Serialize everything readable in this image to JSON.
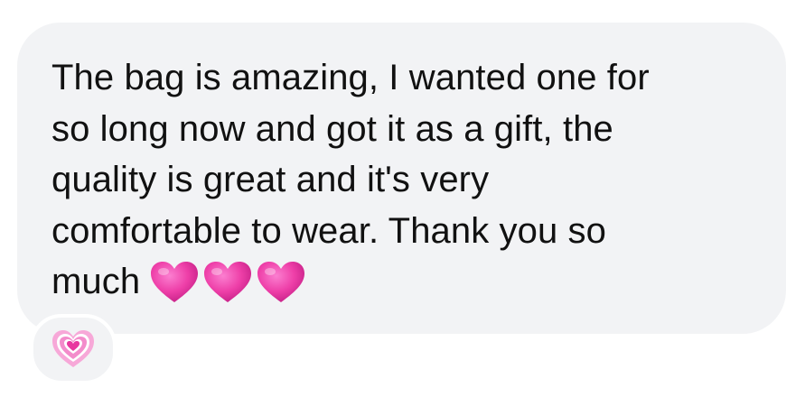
{
  "message": {
    "lines": [
      "The bag is amazing,  I wanted one for",
      "so long now and got it as a gift, the",
      "quality is great and it's very",
      "comfortable to wear. Thank you so",
      "much"
    ],
    "trailing_emoji": [
      "pink-heart-icon",
      "pink-heart-icon",
      "pink-heart-icon"
    ]
  },
  "reaction": {
    "emoji": "growing-heart-icon"
  },
  "colors": {
    "bubble_background": "#f2f3f5",
    "text": "#111111",
    "heart_pink": "#ee3fa8"
  }
}
